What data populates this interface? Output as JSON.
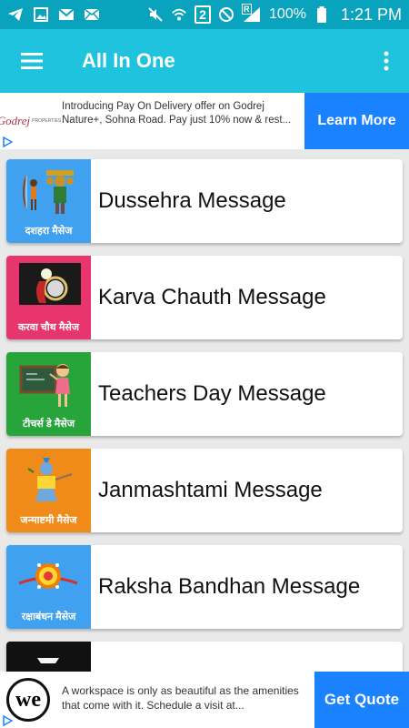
{
  "status_bar": {
    "left_icons": [
      "telegram-icon",
      "gallery-icon",
      "gmail-icon",
      "email-icon"
    ],
    "sim_number": "2",
    "roaming": "R",
    "battery": "100%",
    "time": "1:21 PM"
  },
  "app_bar": {
    "title": "All In One",
    "menu_icon": "hamburger-menu-icon",
    "more_icon": "more-vert-icon"
  },
  "ad_top": {
    "brand": "Godrej",
    "brand_sub": "PROPERTIES",
    "text": "Introducing Pay On Delivery offer on Godrej Nature+, Sohna Road. Pay just 10% now & rest...",
    "cta": "Learn More",
    "cta_color": "#1a82ff"
  },
  "list": [
    {
      "title": "Dussehra Message",
      "caption": "दशहरा मैसेज",
      "bg": "#3fa1f0"
    },
    {
      "title": "Karva Chauth Message",
      "caption": "करवा चौथ मैसेज",
      "bg": "#e8356e"
    },
    {
      "title": "Teachers Day Message",
      "caption": "टीचर्स डे मैसेज",
      "bg": "#27a53a"
    },
    {
      "title": "Janmashtami Message",
      "caption": "जन्माष्टमी मैसेज",
      "bg": "#f08a19"
    },
    {
      "title": "Raksha Bandhan Message",
      "caption": "रक्षाबंधन मैसेज",
      "bg": "#3fa1f0"
    }
  ],
  "ad_bottom": {
    "brand": "we",
    "text": "A workspace is only as beautiful as the amenities that come with it. Schedule a visit at...",
    "cta": "Get Quote"
  },
  "colors": {
    "status_bar": "#0aa3be",
    "app_bar": "#1fc3dd"
  }
}
